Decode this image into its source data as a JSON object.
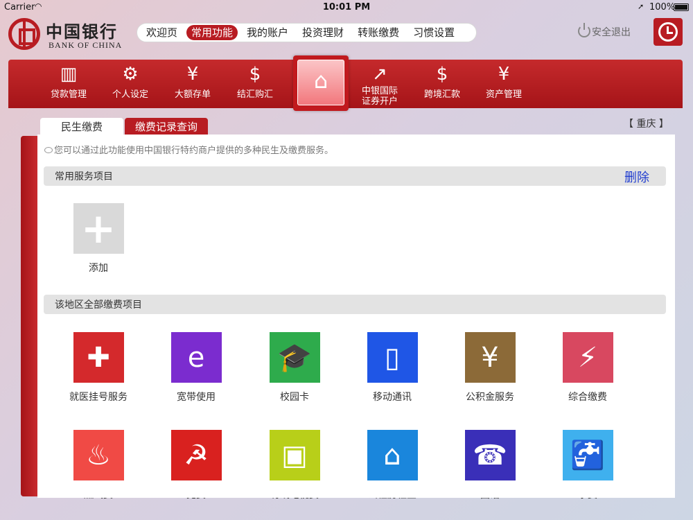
{
  "status": {
    "carrier": "Carrier",
    "time": "10:01 PM",
    "battery": "100%"
  },
  "brand": {
    "cn": "中国银行",
    "en": "BANK OF CHINA"
  },
  "topnav": [
    "欢迎页",
    "常用功能",
    "我的账户",
    "投资理财",
    "转账缴费",
    "习惯设置"
  ],
  "logout_label": "安全退出",
  "funcbar": [
    {
      "label": "贷款管理",
      "icon": "loan-icon",
      "glyph": "▥"
    },
    {
      "label": "个人设定",
      "icon": "gears-icon",
      "glyph": "⚙"
    },
    {
      "label": "大额存单",
      "icon": "certificate-icon",
      "glyph": "¥"
    },
    {
      "label": "结汇购汇",
      "icon": "exchange-icon",
      "glyph": "$"
    },
    {
      "label": "",
      "icon": "house-yen-icon",
      "glyph": "⌂"
    },
    {
      "label": "中银国际\n证券开户",
      "icon": "chart-icon",
      "glyph": "↗"
    },
    {
      "label": "跨境汇款",
      "icon": "globe-dollar-icon",
      "glyph": "$"
    },
    {
      "label": "资产管理",
      "icon": "document-yen-icon",
      "glyph": "¥"
    }
  ],
  "tabs": {
    "ms": "民生缴费",
    "jf": "缴费记录查询"
  },
  "city": "【 重庆 】",
  "notice": "您可以通过此功能使用中国银行特约商户提供的多种民生及缴费服务。",
  "common": {
    "title": "常用服务项目",
    "delete_label": "删除",
    "add_label": "添加"
  },
  "all": {
    "title": "该地区全部缴费项目"
  },
  "services_row1": [
    {
      "label": "就医挂号服务",
      "color": "#d4292c",
      "icon": "hospital-icon",
      "glyph": "✚"
    },
    {
      "label": "宽带使用",
      "color": "#7b2ccf",
      "icon": "broadband-icon",
      "glyph": "e"
    },
    {
      "label": "校园卡",
      "color": "#2eab4c",
      "icon": "graduation-icon",
      "glyph": "🎓"
    },
    {
      "label": "移动通讯",
      "color": "#1f56e6",
      "icon": "mobile-phone-icon",
      "glyph": "▯"
    },
    {
      "label": "公积金服务",
      "color": "#8c6a38",
      "icon": "house-yen-icon",
      "glyph": "¥"
    },
    {
      "label": "综合缴费",
      "color": "#d84860",
      "icon": "utilities-icon",
      "glyph": "⚡"
    }
  ],
  "services_row2": [
    {
      "label": "燃气费",
      "color": "#f04a45",
      "icon": "flame-icon",
      "glyph": "♨"
    },
    {
      "label": "党费",
      "color": "#d9211f",
      "icon": "hammer-sickle-icon",
      "glyph": "☭"
    },
    {
      "label": "有线电视费",
      "color": "#b8cf19",
      "icon": "tv-icon",
      "glyph": "▣"
    },
    {
      "label": "公租房租金",
      "color": "#1a86dc",
      "icon": "public-housing-icon",
      "glyph": "⌂"
    },
    {
      "label": "固话",
      "color": "#3a2fb8",
      "icon": "telephone-icon",
      "glyph": "☎"
    },
    {
      "label": "水费",
      "color": "#3fb0ee",
      "icon": "water-tap-icon",
      "glyph": "🚰"
    }
  ]
}
